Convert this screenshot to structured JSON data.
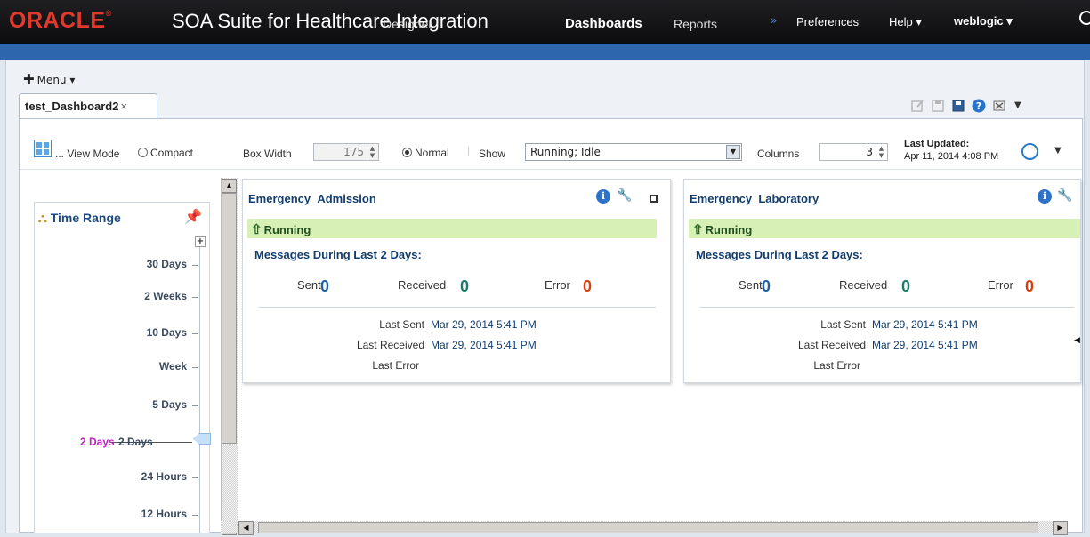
{
  "header": {
    "logo": "ORACLE",
    "app_title": "SOA Suite for Healthcare Integration",
    "nav": {
      "designer": "Designer",
      "dashboards": "Dashboards",
      "reports": "Reports",
      "more": "»",
      "preferences": "Preferences",
      "help": "Help ▾",
      "user": "weblogic ▾"
    }
  },
  "menu": {
    "label": "Menu ▾"
  },
  "tab": {
    "label": "test_Dashboard2",
    "close": "×"
  },
  "toolbar": {
    "view_mode": "... View Mode",
    "compact": "Compact",
    "box_width_label": "Box Width",
    "box_width_value": "175",
    "normal": "Normal",
    "show_label": "Show",
    "show_value": "Running; Idle",
    "columns_label": "Columns",
    "columns_value": "3",
    "last_updated_label": "Last Updated:",
    "last_updated_value": "Apr 11, 2014 4:08 PM"
  },
  "time_range": {
    "title": "Time Range",
    "ticks": [
      "30 Days",
      "2 Weeks",
      "10 Days",
      "Week",
      "5 Days",
      "24 Hours",
      "12 Hours"
    ],
    "selected_label": "2 Days",
    "selected_tick": "2 Days"
  },
  "cards": [
    {
      "title": "Emergency_Admission",
      "status": "Running",
      "messages_header": "Messages During Last 2 Days:",
      "sent_label": "Sent",
      "sent": "0",
      "received_label": "Received",
      "received": "0",
      "error_label": "Error",
      "error": "0",
      "last_sent_label": "Last Sent",
      "last_sent": "Mar 29, 2014 5:41 PM",
      "last_received_label": "Last Received",
      "last_received": "Mar 29, 2014 5:41 PM",
      "last_error_label": "Last Error"
    },
    {
      "title": "Emergency_Laboratory",
      "status": "Running",
      "messages_header": "Messages During Last 2 Days:",
      "sent_label": "Sent",
      "sent": "0",
      "received_label": "Received",
      "received": "0",
      "error_label": "Error",
      "error": "0",
      "last_sent_label": "Last Sent",
      "last_sent": "Mar 29, 2014 5:41 PM",
      "last_received_label": "Last Received",
      "last_received": "Mar 29, 2014 5:41 PM",
      "last_error_label": "Last Error"
    }
  ],
  "colors": {
    "sent": "#1f5fa6",
    "received": "#1a7a6a",
    "error": "#d8410e",
    "running_bg": "#d6f0b6",
    "title": "#123d6e"
  }
}
